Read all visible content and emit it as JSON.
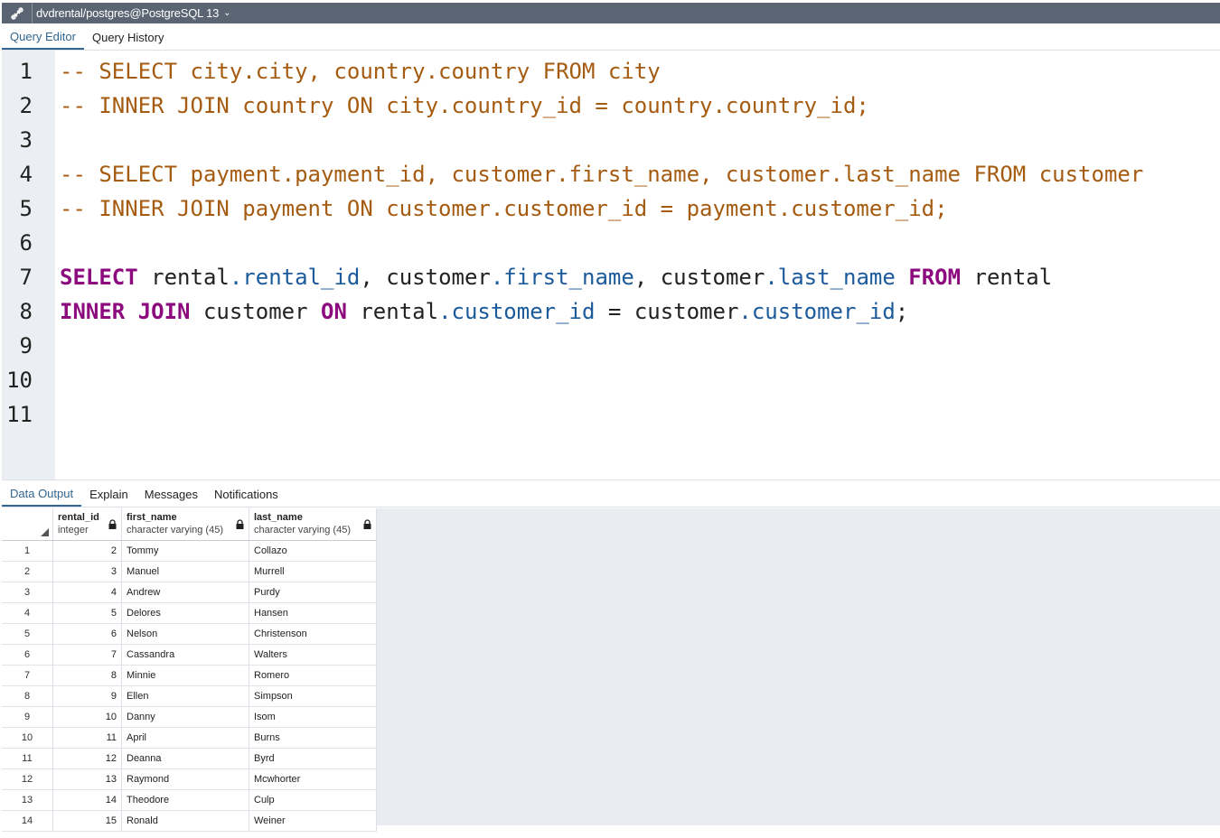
{
  "topbar": {
    "connection": "dvdrental/postgres@PostgreSQL 13"
  },
  "editor_tabs": [
    "Query Editor",
    "Query History"
  ],
  "editor": {
    "line_numbers": [
      "1",
      "2",
      "3",
      "4",
      "5",
      "6",
      "7",
      "8",
      "9",
      "10",
      "11"
    ],
    "lines": [
      "-- SELECT city.city, country.country FROM city",
      "-- INNER JOIN country ON city.country_id = country.country_id;",
      "",
      "-- SELECT payment.payment_id, customer.first_name, customer.last_name FROM customer",
      "-- INNER JOIN payment ON customer.customer_id = payment.customer_id;",
      "",
      "SELECT rental.rental_id, customer.first_name, customer.last_name FROM rental",
      "INNER JOIN customer ON rental.customer_id = customer.customer_id;",
      "",
      "",
      ""
    ]
  },
  "output_tabs": [
    "Data Output",
    "Explain",
    "Messages",
    "Notifications"
  ],
  "grid": {
    "columns": [
      {
        "name": "rental_id",
        "type": "integer"
      },
      {
        "name": "first_name",
        "type": "character varying (45)"
      },
      {
        "name": "last_name",
        "type": "character varying (45)"
      }
    ],
    "rows": [
      [
        "1",
        "2",
        "Tommy",
        "Collazo"
      ],
      [
        "2",
        "3",
        "Manuel",
        "Murrell"
      ],
      [
        "3",
        "4",
        "Andrew",
        "Purdy"
      ],
      [
        "4",
        "5",
        "Delores",
        "Hansen"
      ],
      [
        "5",
        "6",
        "Nelson",
        "Christenson"
      ],
      [
        "6",
        "7",
        "Cassandra",
        "Walters"
      ],
      [
        "7",
        "8",
        "Minnie",
        "Romero"
      ],
      [
        "8",
        "9",
        "Ellen",
        "Simpson"
      ],
      [
        "9",
        "10",
        "Danny",
        "Isom"
      ],
      [
        "10",
        "11",
        "April",
        "Burns"
      ],
      [
        "11",
        "12",
        "Deanna",
        "Byrd"
      ],
      [
        "12",
        "13",
        "Raymond",
        "Mcwhorter"
      ],
      [
        "13",
        "14",
        "Theodore",
        "Culp"
      ],
      [
        "14",
        "15",
        "Ronald",
        "Weiner"
      ]
    ]
  }
}
